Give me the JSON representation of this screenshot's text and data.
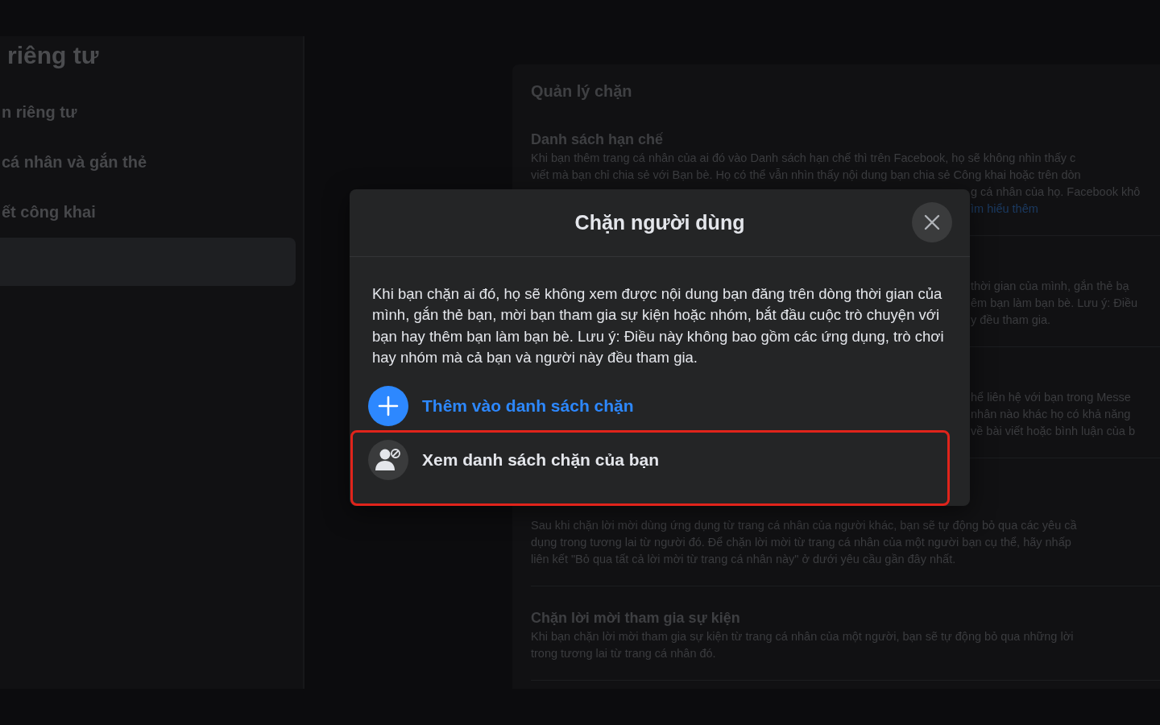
{
  "sidebar": {
    "heading": "riêng tư",
    "items": [
      {
        "label": "n riêng tư",
        "selected": false
      },
      {
        "label": "cá nhân và gắn thẻ",
        "selected": false
      },
      {
        "label": "ết công khai",
        "selected": false
      },
      {
        "selected": true
      }
    ]
  },
  "main": {
    "heading": "Quản lý chặn",
    "sections": [
      {
        "title": "Danh sách hạn chế",
        "lines": [
          {
            "text": "Khi bạn thêm trang cá nhân của ai đó vào Danh sách hạn chế thì trên Facebook, họ sẽ không nhìn thấy c",
            "kind": "text",
            "covered": false
          },
          {
            "text": "viết mà bạn chỉ chia sẻ với Bạn bè. Họ có thể vẫn nhìn thấy nội dung bạn chia sẻ Công khai hoặc trên dòn",
            "kind": "text",
            "covered": false
          },
          {
            "text": "g cá nhân của họ. Facebook khô",
            "kind": "text",
            "covered": true
          },
          {
            "text": "ìm hiểu thêm",
            "kind": "link",
            "covered": true
          }
        ]
      },
      {
        "lines": [
          {
            "text": "thời gian của mình, gắn thẻ bạ",
            "kind": "text",
            "covered": true
          },
          {
            "text": "êm bạn làm bạn bè. Lưu ý: Điều",
            "kind": "text",
            "covered": true
          },
          {
            "text": "y đều tham gia.",
            "kind": "text",
            "covered": true
          }
        ]
      },
      {
        "lines": [
          {
            "text": "hể liên hệ với bạn trong Messe",
            "kind": "text",
            "covered": true
          },
          {
            "text": "nhân nào khác họ có khả năng",
            "kind": "text",
            "covered": true
          },
          {
            "text": "về bài viết hoặc bình luận của b",
            "kind": "text",
            "covered": true
          }
        ]
      },
      {
        "lines": [
          {
            "text": "Sau khi chặn lời mời dùng ứng dụng từ trang cá nhân của người khác, bạn sẽ tự động bỏ qua các yêu cầ",
            "kind": "text",
            "covered": false
          },
          {
            "text": "dụng trong tương lai từ người đó. Để chặn lời mời từ trang cá nhân của một người bạn cụ thể, hãy nhấp",
            "kind": "text",
            "covered": false
          },
          {
            "text": "liên kết \"Bỏ qua tất cả lời mời từ trang cá nhân này\" ở dưới yêu cầu gần đây nhất.",
            "kind": "text",
            "covered": false
          }
        ]
      },
      {
        "title": "Chặn lời mời tham gia sự kiện",
        "lines": [
          {
            "text": "Khi bạn chặn lời mời tham gia sự kiện từ trang cá nhân của một người, bạn sẽ tự động bỏ qua những lời",
            "kind": "text",
            "covered": false
          },
          {
            "text": "trong tương lai từ trang cá nhân đó.",
            "kind": "text",
            "covered": false
          }
        ]
      }
    ]
  },
  "dialog": {
    "title": "Chặn người dùng",
    "description": "Khi bạn chặn ai đó, họ sẽ không xem được nội dung bạn đăng trên dòng thời gian của mình, gắn thẻ bạn, mời bạn tham gia sự kiện hoặc nhóm, bắt đầu cuộc trò chuyện với bạn hay thêm bạn làm bạn bè. Lưu ý: Điều này không bao gồm các ứng dụng, trò chơi hay nhóm mà cả bạn và người này đều tham gia.",
    "options": [
      {
        "label": "Thêm vào danh sách chặn",
        "kind": "add",
        "highlighted": false
      },
      {
        "label": "Xem danh sách chặn của bạn",
        "kind": "view",
        "highlighted": true
      }
    ]
  }
}
